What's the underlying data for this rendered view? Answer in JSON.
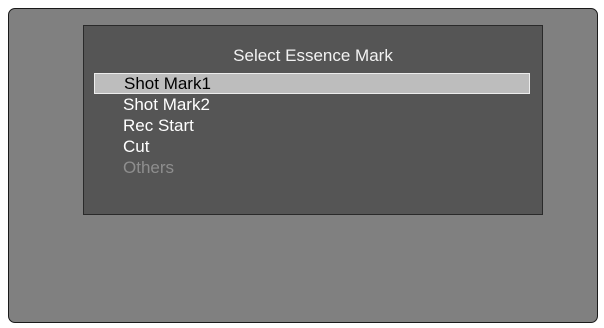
{
  "menu": {
    "title": "Select Essence Mark",
    "items": [
      {
        "label": "Shot Mark1",
        "selected": true,
        "enabled": true
      },
      {
        "label": "Shot Mark2",
        "selected": false,
        "enabled": true
      },
      {
        "label": "Rec Start",
        "selected": false,
        "enabled": true
      },
      {
        "label": "Cut",
        "selected": false,
        "enabled": true
      },
      {
        "label": "Others",
        "selected": false,
        "enabled": false
      }
    ]
  },
  "colors": {
    "screen_bg": "#808080",
    "menu_bg": "#555555",
    "highlight_bg": "#bdbdbd",
    "text": "#ffffff",
    "disabled_text": "#8e8e8e"
  }
}
